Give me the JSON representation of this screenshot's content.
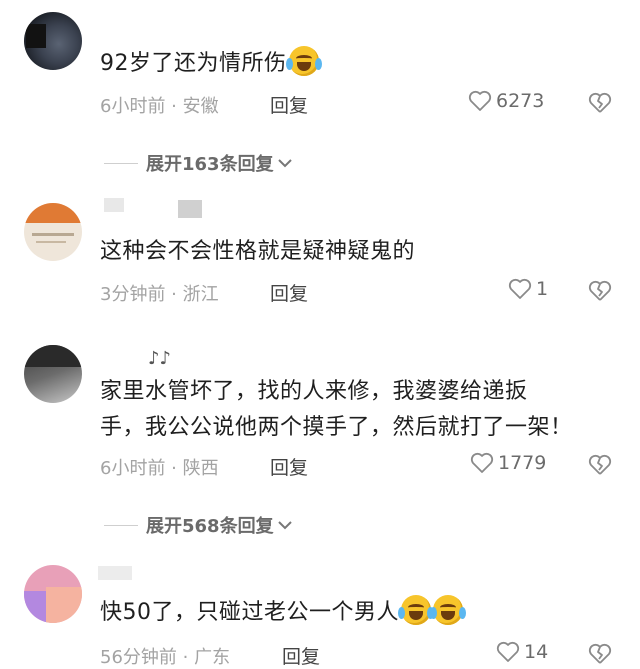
{
  "comments": [
    {
      "text": "92岁了还为情所伤",
      "emoji_count": 1,
      "time_location": "6小时前 · 安徽",
      "reply_label": "回复",
      "likes": "6273"
    },
    {
      "text": "这种会不会性格就是疑神疑鬼的",
      "emoji_count": 0,
      "time_location": "3分钟前 · 浙江",
      "reply_label": "回复",
      "likes": "1"
    },
    {
      "text_line1": "家里水管坏了，找的人来修，我婆婆给递扳",
      "text_line2": "手，我公公说他两个摸手了，然后就打了一架！",
      "emoji_count": 0,
      "time_location": "6小时前 · 陕西",
      "reply_label": "回复",
      "likes": "1779"
    },
    {
      "text": "快50了，只碰过老公一个男人",
      "emoji_count": 2,
      "time_location": "56分钟前 · 广东",
      "reply_label": "回复",
      "likes": "14"
    }
  ],
  "expand_replies": [
    {
      "label": "展开163条回复"
    },
    {
      "label": "展开568条回复"
    }
  ],
  "colors": {
    "text": "#1f1f1f",
    "meta": "#a3a3a3",
    "emoji": "#f7c52b"
  },
  "icons": {
    "like": "heart-outline-icon",
    "dislike": "broken-heart-icon",
    "expand": "chevron-down-icon",
    "emoji": "crying-laughing-emoji"
  }
}
